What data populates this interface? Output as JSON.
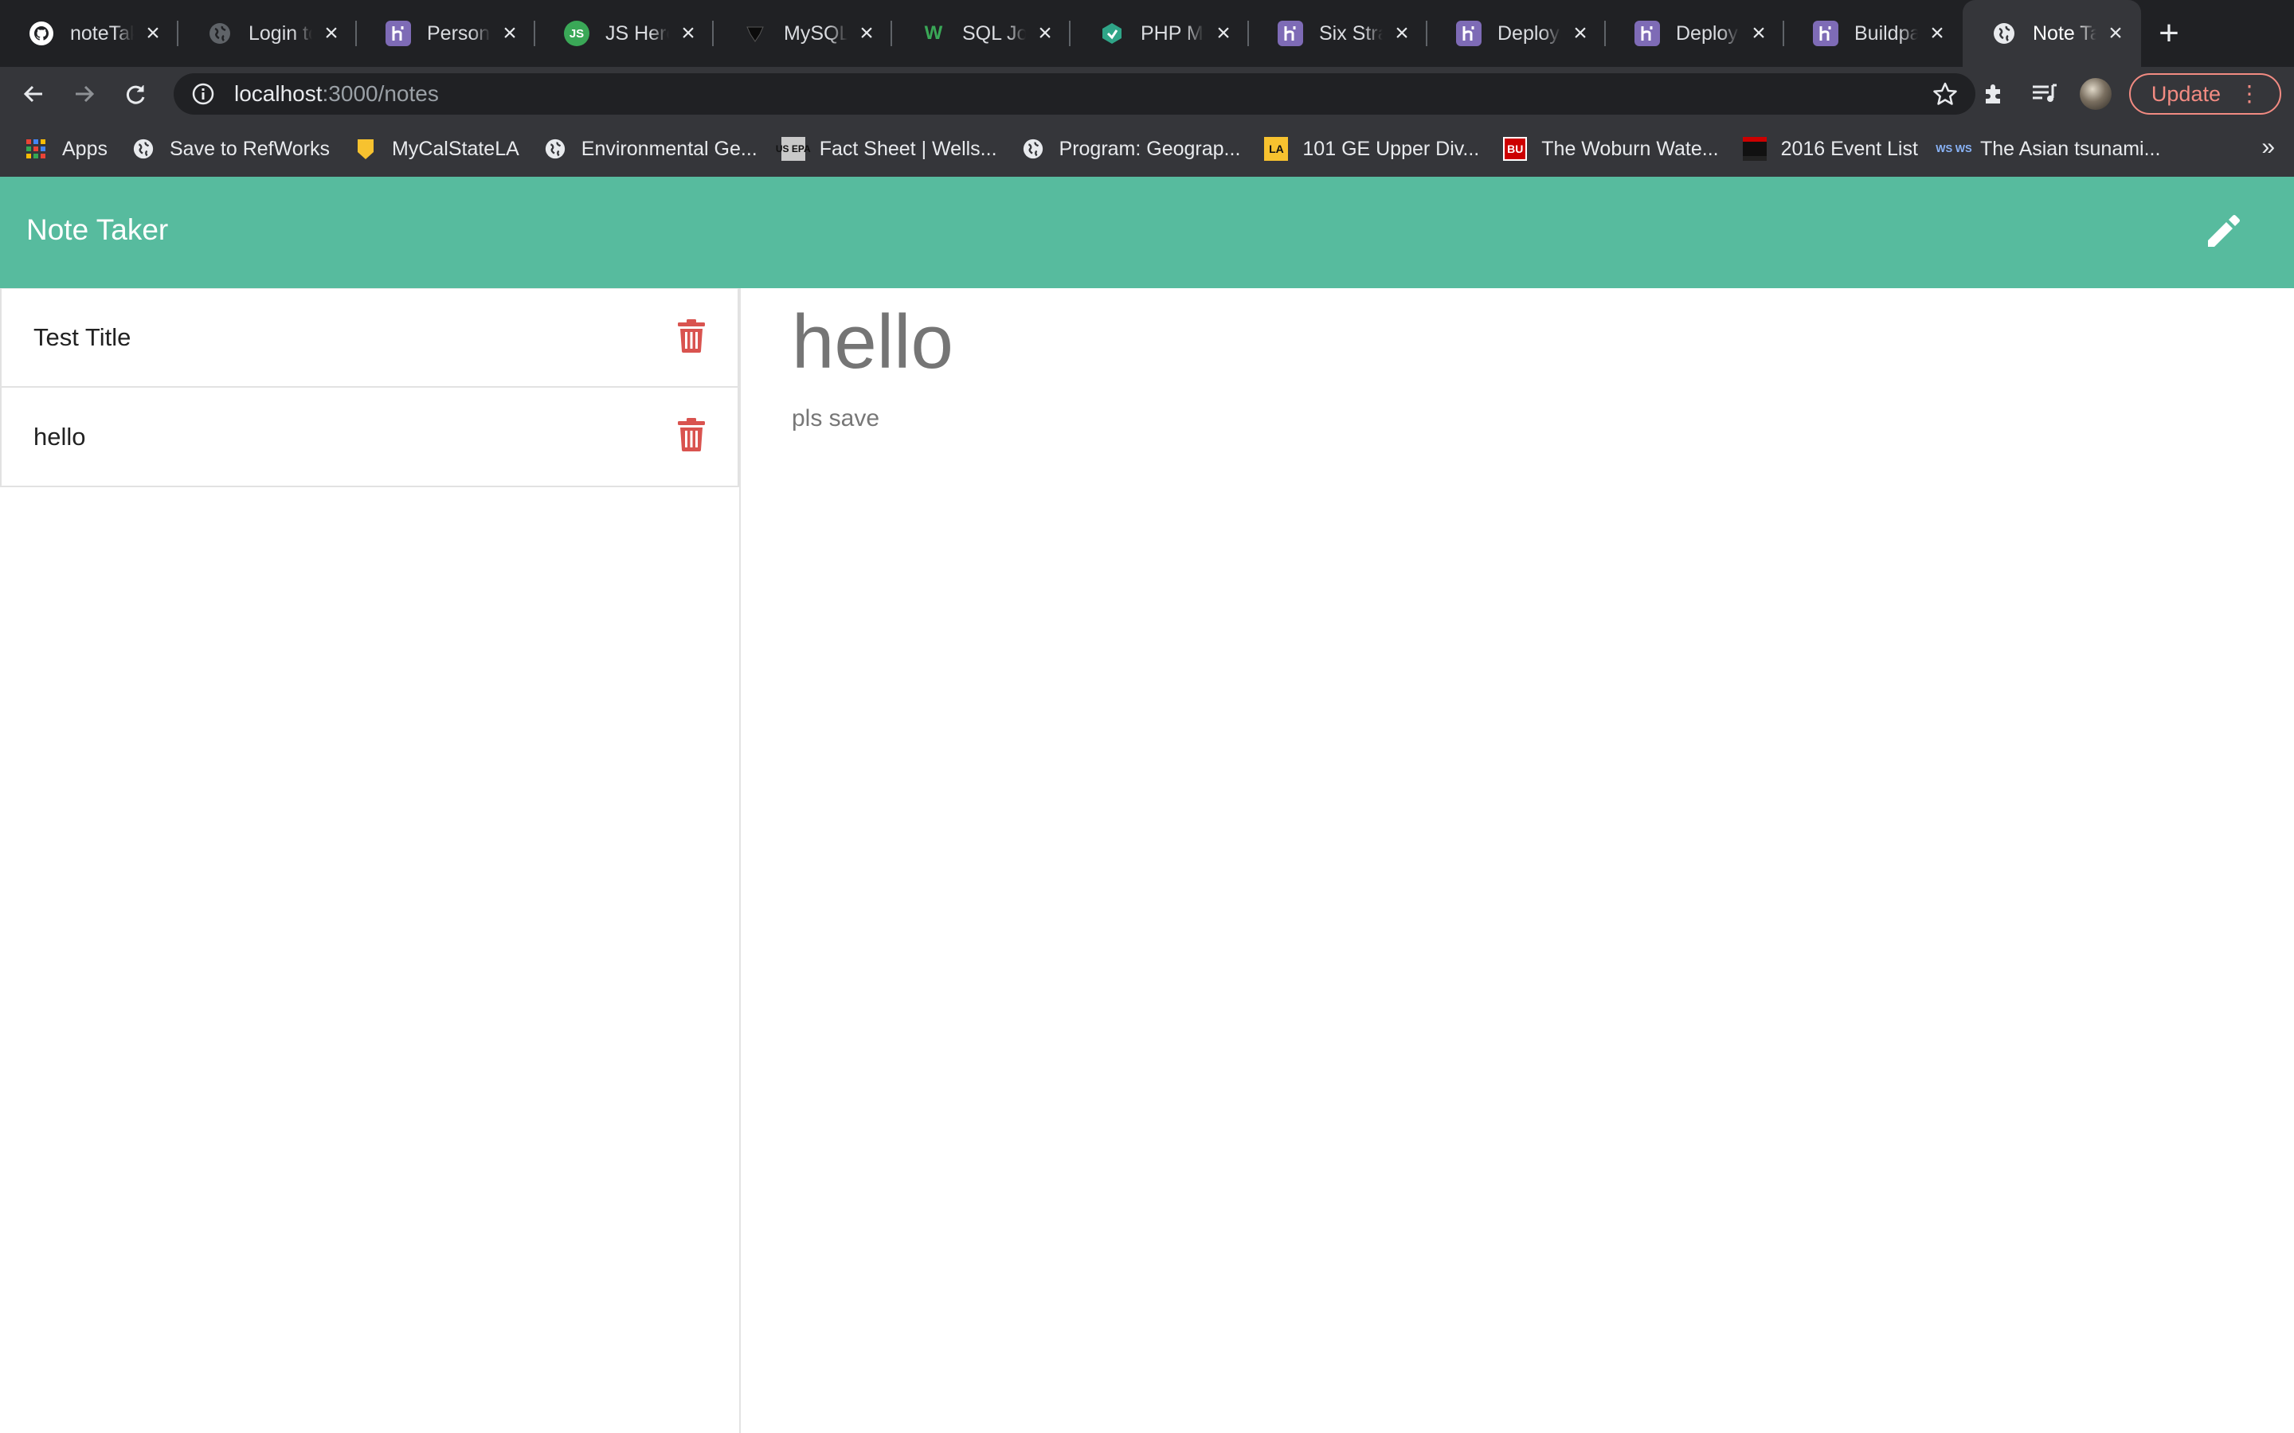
{
  "browser": {
    "tabs": [
      {
        "title": "noteTaker",
        "favicon": "github-icon",
        "color": "#ffffff"
      },
      {
        "title": "Login to",
        "favicon": "globe-icon",
        "color": "#5f6368"
      },
      {
        "title": "Personal",
        "favicon": "heroku-icon",
        "color": "#7e6bb6"
      },
      {
        "title": "JS Hero",
        "favicon": "jshero-icon",
        "color": "#3aa857"
      },
      {
        "title": "MySQL I",
        "favicon": "mysql-icon",
        "color": "#111111"
      },
      {
        "title": "SQL Joins",
        "favicon": "w3schools-icon",
        "color": "#3aa857"
      },
      {
        "title": "PHP MySQL",
        "favicon": "php-icon",
        "color": "#2fa588"
      },
      {
        "title": "Six Strat",
        "favicon": "heroku-icon",
        "color": "#7e6bb6"
      },
      {
        "title": "Deploying",
        "favicon": "heroku-icon",
        "color": "#7e6bb6"
      },
      {
        "title": "Deploying",
        "favicon": "heroku-icon",
        "color": "#7e6bb6"
      },
      {
        "title": "Buildpacks",
        "favicon": "heroku-icon",
        "color": "#7e6bb6"
      },
      {
        "title": "Note Taker",
        "favicon": "globe-icon",
        "color": "#ffffff",
        "active": true
      }
    ],
    "url": {
      "host": "localhost",
      "path": ":3000/notes"
    },
    "update_label": "Update",
    "bookmarks": [
      {
        "label": "Apps",
        "icon": "apps-grid-icon"
      },
      {
        "label": "Save to RefWorks",
        "icon": "globe-icon"
      },
      {
        "label": "MyCalStateLA",
        "icon": "csula-icon"
      },
      {
        "label": "Environmental Ge...",
        "icon": "globe-icon"
      },
      {
        "label": "Fact Sheet | Wells...",
        "icon": "epa-icon"
      },
      {
        "label": "Program: Geograp...",
        "icon": "globe-icon"
      },
      {
        "label": "101 GE Upper Div...",
        "icon": "csula-ge-icon"
      },
      {
        "label": "The Woburn Wate...",
        "icon": "bu-icon"
      },
      {
        "label": "2016 Event List",
        "icon": "event-icon"
      },
      {
        "label": "The Asian tsunami...",
        "icon": "ws-icon"
      }
    ]
  },
  "app": {
    "brand": "Note Taker",
    "notes": [
      {
        "title": "Test Title"
      },
      {
        "title": "hello"
      }
    ],
    "active_note": {
      "title": "hello",
      "text": "pls save"
    }
  },
  "colors": {
    "header": "#57bb9e",
    "trash": "#d9534f",
    "tab_bar": "#202124",
    "toolbar": "#35363a"
  }
}
